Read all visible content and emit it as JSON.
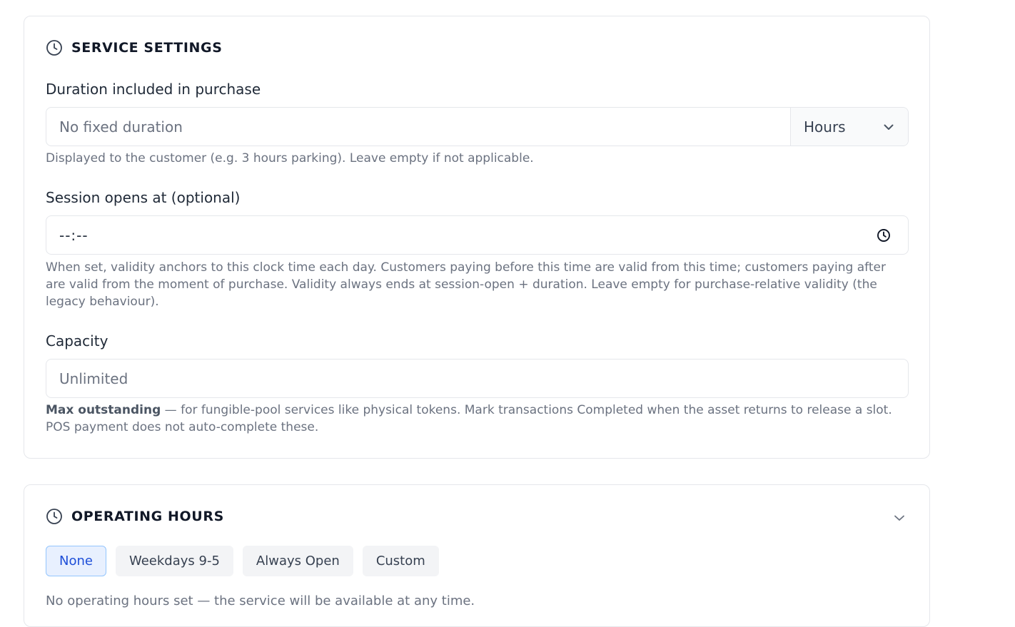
{
  "service_settings": {
    "title": "SERVICE SETTINGS",
    "duration": {
      "label": "Duration included in purchase",
      "placeholder": "No fixed duration",
      "unit_selected": "Hours",
      "help": "Displayed to the customer (e.g. 3 hours parking). Leave empty if not applicable."
    },
    "session_opens": {
      "label": "Session opens at (optional)",
      "value": "--:--",
      "help": "When set, validity anchors to this clock time each day. Customers paying before this time are valid from this time; customers paying after are valid from the moment of purchase. Validity always ends at session-open + duration. Leave empty for purchase-relative validity (the legacy behaviour)."
    },
    "capacity": {
      "label": "Capacity",
      "placeholder": "Unlimited",
      "help_strong": "Max outstanding",
      "help": " — for fungible-pool services like physical tokens. Mark transactions Completed when the asset returns to release a slot. POS payment does not auto-complete these."
    }
  },
  "operating_hours": {
    "title": "OPERATING HOURS",
    "presets": [
      "None",
      "Weekdays 9-5",
      "Always Open",
      "Custom"
    ],
    "active_preset": "None",
    "note": "No operating hours set — the service will be available at any time."
  },
  "icons": {
    "section_icon": "clock-icon",
    "select_icon": "chevron-down-icon",
    "time_icon": "clock-icon"
  },
  "colors": {
    "accent": "#1d4ed8",
    "accent_bg": "#e8f0fe",
    "border": "#e5e7eb",
    "muted_text": "#6b7280"
  }
}
